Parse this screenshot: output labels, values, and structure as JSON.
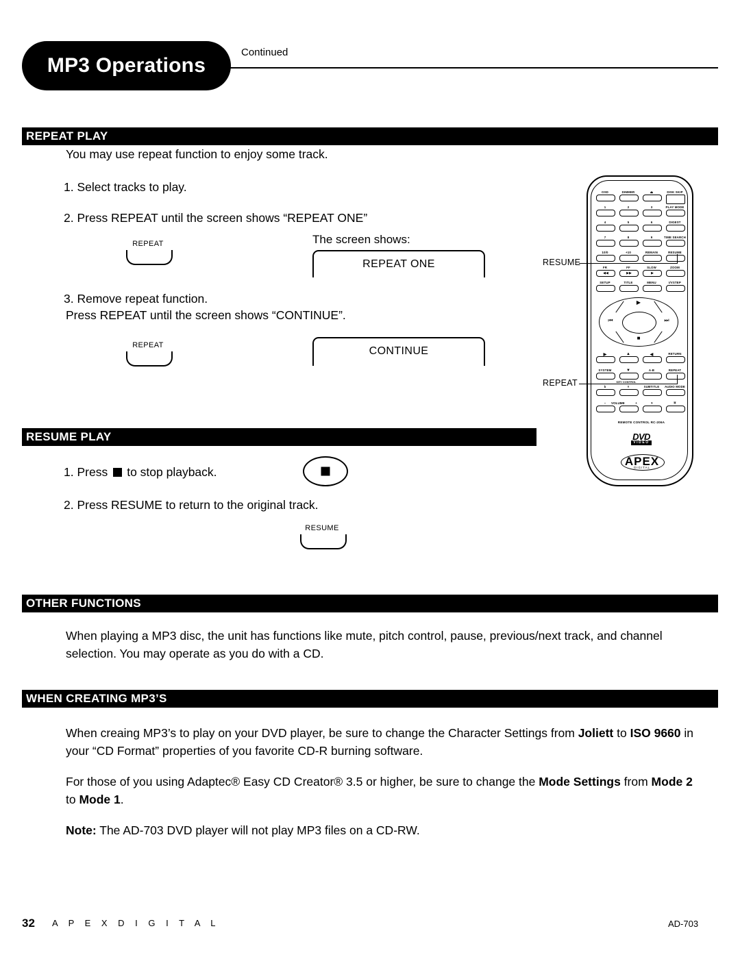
{
  "header": {
    "title": "MP3 Operations",
    "continued": "Continued"
  },
  "sections": {
    "repeat_play": {
      "heading": "REPEAT PLAY",
      "intro": "You may use repeat function to enjoy some track.",
      "step1": "1. Select tracks to play.",
      "step2": "2. Press REPEAT until the screen shows “REPEAT ONE”",
      "screen_shows_label": "The screen shows:",
      "screen_value_1": "REPEAT ONE",
      "step3_line1": "3. Remove repeat function.",
      "step3_line2": "Press REPEAT until the screen shows “CONTINUE”.",
      "screen_value_2": "CONTINUE",
      "button_label_1": "REPEAT",
      "button_label_2": "REPEAT"
    },
    "resume_play": {
      "heading": "RESUME PLAY",
      "step1_before": "1. Press",
      "step1_after": "to stop playback.",
      "step2": "2. Press RESUME to return to the original track.",
      "button_label": "RESUME"
    },
    "other_functions": {
      "heading": "OTHER FUNCTIONS",
      "body": "When playing a MP3 disc, the unit has functions like mute, pitch control, pause, previous/next track, and channel selection.  You may operate as you do with a CD."
    },
    "when_creating": {
      "heading": "WHEN CREATING MP3’S",
      "p1_a": "When creaing MP3’s to play on your DVD player, be sure to change the Character Settings from ",
      "p1_b": "Joliett",
      "p1_c": " to ",
      "p1_d": "ISO 9660",
      "p1_e": " in your “CD Format” properties of you favorite CD-R burning software.",
      "p2_a": "For those of you using Adaptec® Easy CD Creator® 3.5 or higher, be sure to change the ",
      "p2_b": "Mode Settings",
      "p2_c": " from ",
      "p2_d": "Mode 2",
      "p2_e": " to ",
      "p2_f": "Mode 1",
      "p2_g": ".",
      "note_label": "Note:",
      "note_body": " The AD-703 DVD player will not play MP3 files on a CD-RW."
    }
  },
  "remote": {
    "callout_resume": "RESUME",
    "callout_repeat": "REPEAT",
    "model_text": "REMOTE CONTROL RC-206A",
    "dvd_logo": "DVD",
    "dvd_logo_sub": "VIDEO",
    "brand": "APEX",
    "brand_sub": "DIGITAL",
    "keys": {
      "r1c1": "OSD",
      "r1c2": "DIMMER",
      "r1c3": "⏏",
      "r1c4": "DISK SKIP",
      "r2c1": "1",
      "r2c2": "2",
      "r2c3": "3",
      "r2c4": "PLAY MODE",
      "r3c1": "4",
      "r3c2": "5",
      "r3c3": "6",
      "r3c4": "DIGEST",
      "r4c1": "7",
      "r4c2": "8",
      "r4c3": "9",
      "r4c4": "TIME SEARCH",
      "r5c1": "10/0",
      "r5c2": "+10",
      "r5c3": "REMAIN",
      "r5c4": "RESUME",
      "r6c1": "FR",
      "r6c2": "FF",
      "r6c3": "SLOW",
      "r6c4": "ZOOM",
      "r6c1g": "◀◀",
      "r6c2g": "▶▶",
      "r6c3g": "▶",
      "r7c1": "SETUP",
      "r7c2": "TITLE",
      "r7c3": "MENU",
      "r7c4": "I/VSTEP",
      "dpad_play": "▶",
      "dpad_prev": "⏮",
      "dpad_next": "⏭",
      "dpad_stop": "■",
      "r8c1": "▶",
      "r8c2": "▲",
      "r8c3": "◀",
      "r8c4": "RETURN",
      "r9c1": "SYSTEM",
      "r9c2": "▼",
      "r9c3": "A-B",
      "r9c4": "REPEAT",
      "keycontrol": "KEY CONTROL",
      "r10c1": "b",
      "r10c2": "#",
      "r10c3": "SUBTITLE",
      "r10c4": "AUDIO MODE",
      "r11c1": "–",
      "r11c1b": "VOLUME",
      "r11c1c": "+",
      "r11c3": "◑",
      "r11c4": "¤"
    }
  },
  "footer": {
    "page_number": "32",
    "brand": "A P E X   D I G I T A L",
    "model": "AD-703"
  }
}
